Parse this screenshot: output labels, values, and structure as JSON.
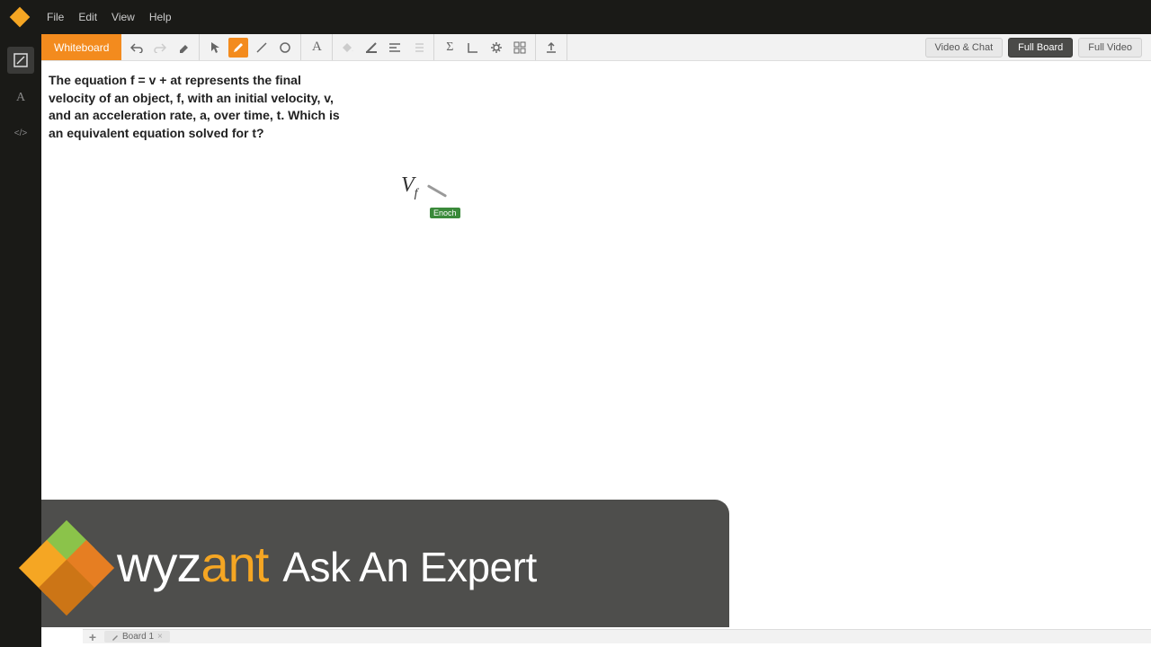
{
  "top_menu": {
    "file": "File",
    "edit": "Edit",
    "view": "View",
    "help": "Help"
  },
  "whiteboard_tab": "Whiteboard",
  "buttons": {
    "video_chat": "Video & Chat",
    "full_board": "Full Board",
    "full_video": "Full Video"
  },
  "problem": "The equation f = v + at represents the final velocity of an object, f, with an initial velocity, v, and an acceleration rate, a, over time, t. Which is an equivalent equation solved for t?",
  "drawing": {
    "symbol": "V",
    "subscript": "f",
    "user_tag": "Enoch"
  },
  "bottom": {
    "board_tab": "Board 1"
  },
  "banner": {
    "brand_1": "wyz",
    "brand_2": "ant",
    "tagline": "Ask An Expert"
  }
}
